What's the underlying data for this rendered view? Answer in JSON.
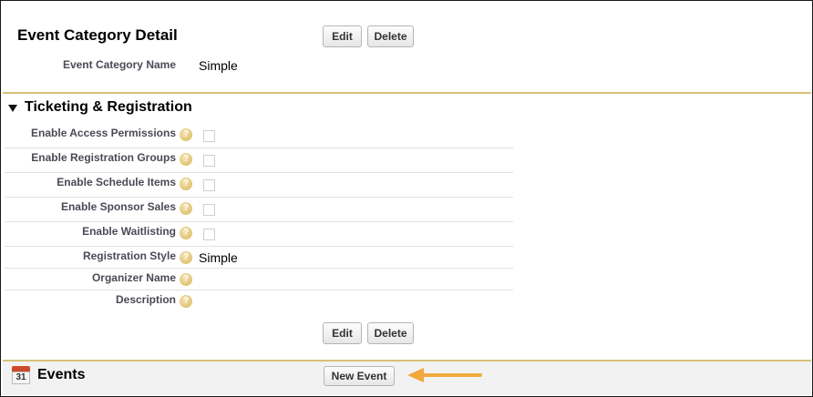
{
  "detail": {
    "title": "Event Category Detail",
    "edit_label": "Edit",
    "delete_label": "Delete",
    "name_label": "Event Category Name",
    "name_value": "Simple"
  },
  "ticketing": {
    "title": "Ticketing & Registration",
    "fields": [
      {
        "label": "Enable Access Permissions",
        "type": "checkbox",
        "checked": false
      },
      {
        "label": "Enable Registration Groups",
        "type": "checkbox",
        "checked": false
      },
      {
        "label": "Enable Schedule Items",
        "type": "checkbox",
        "checked": false
      },
      {
        "label": "Enable Sponsor Sales",
        "type": "checkbox",
        "checked": false
      },
      {
        "label": "Enable Waitlisting",
        "type": "checkbox",
        "checked": false
      },
      {
        "label": "Registration Style",
        "type": "text",
        "value": "Simple"
      },
      {
        "label": "Organizer Name",
        "type": "text",
        "value": ""
      },
      {
        "label": "Description",
        "type": "text",
        "value": ""
      }
    ],
    "help_glyph": "?",
    "edit_label": "Edit",
    "delete_label": "Delete"
  },
  "events": {
    "title": "Events",
    "calendar_day": "31",
    "new_event_label": "New Event",
    "icon": "calendar-icon"
  },
  "colors": {
    "section_border": "#d7c17a",
    "arrow": "#f2a93b",
    "label_text": "#4a4a56"
  }
}
